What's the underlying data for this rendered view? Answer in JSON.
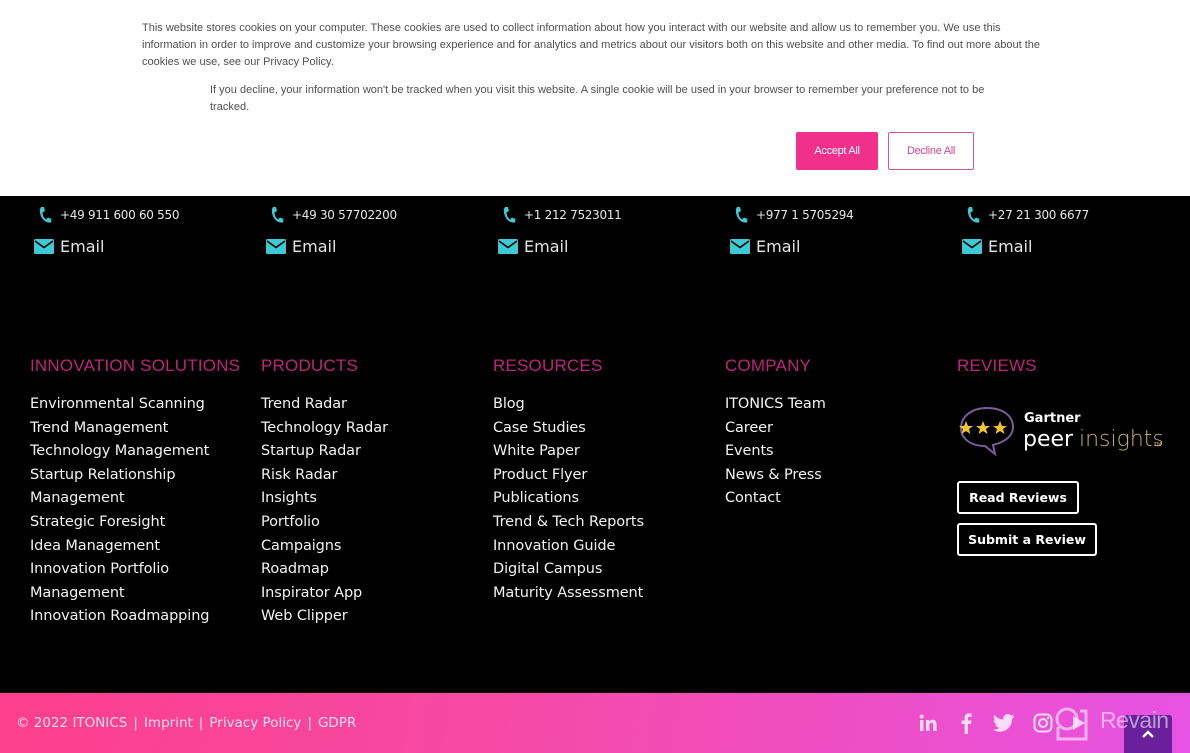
{
  "cookie_banner": {
    "text_main": "This website stores cookies on your computer. These cookies are used to collect information about how you interact with our website and allow us to remember you. We use this information in order to improve and customize your browsing experience and for analytics and metrics about our visitors both on this website and other media. To find out more about the cookies we use, see our Privacy Policy.",
    "text_decline": "If you decline, your information won't be tracked when you visit this website. A single cookie will be used in your browser to remember your preference not to be tracked.",
    "accept_label": "Accept All",
    "decline_label": "Decline All",
    "accent_color": "#f0308b"
  },
  "contacts": [
    {
      "phone": "+49 911 600 60 550",
      "email_label": "Email"
    },
    {
      "phone": "+49 30 57702200",
      "email_label": "Email"
    },
    {
      "phone": "+1 212 7523011",
      "email_label": "Email"
    },
    {
      "phone": "+977 1 5705294",
      "email_label": "Email"
    },
    {
      "phone": "+27 21 300 6677",
      "email_label": "Email"
    }
  ],
  "columns": {
    "solutions": {
      "title": "INNOVATION SOLUTIONS",
      "items": [
        "Environmental Scanning",
        "Trend Management",
        "Technology Management",
        "Startup Relationship",
        "Management",
        "Strategic Foresight",
        "Idea Management",
        "Innovation Portfolio",
        "Management",
        "Innovation Roadmapping"
      ]
    },
    "products": {
      "title": "PRODUCTS",
      "items": [
        "Trend Radar",
        "Technology Radar",
        "Startup Radar",
        "Risk Radar",
        "Insights",
        "Portfolio",
        "Campaigns",
        "Roadmap",
        "Inspirator App",
        "Web Clipper"
      ]
    },
    "resources": {
      "title": "RESOURCES",
      "items": [
        "Blog",
        "Case Studies",
        "White Paper",
        "Product Flyer",
        "Publications",
        "Trend & Tech Reports",
        "Innovation Guide",
        "Digital Campus",
        "Maturity Assessment"
      ]
    },
    "company": {
      "title": "COMPANY",
      "items": [
        "ITONICS Team",
        "Career",
        "Events",
        "News & Press",
        "Contact"
      ]
    },
    "reviews": {
      "title": "REVIEWS",
      "logo_top": "Gartner",
      "logo_peer": "peer",
      "logo_insights": "insights",
      "logo_tm": "TM",
      "stars": 3,
      "read_label": "Read Reviews",
      "submit_label": "Submit a Review"
    }
  },
  "footer": {
    "copyright": "© 2022 ITONICS",
    "separator": "|",
    "links": [
      "Imprint",
      "Privacy Policy",
      "GDPR"
    ],
    "social": [
      "linkedin-icon",
      "facebook-icon",
      "twitter-icon",
      "instagram-icon",
      "youtube-icon"
    ],
    "watermark": "Revain",
    "gradient": [
      "#fd3f8c",
      "#e753e4"
    ],
    "to_top_color": "#6a1f9c"
  },
  "colors": {
    "heading": "#c0237a",
    "icon_teal": "#3ec9d6",
    "background": "#000000"
  }
}
